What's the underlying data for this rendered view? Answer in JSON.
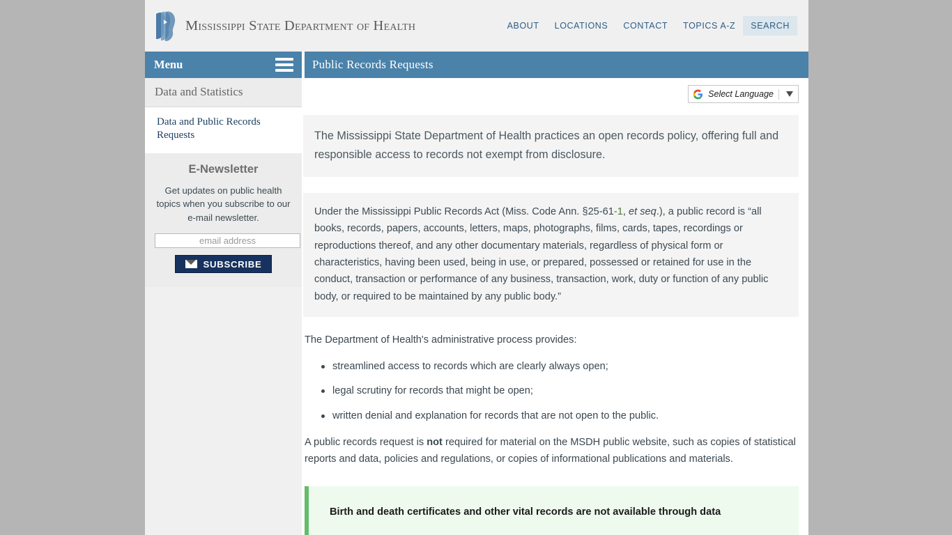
{
  "site": {
    "title": "Mississippi State Department of Health",
    "logo_icon": "msdh-profiles-logo-icon"
  },
  "topnav": {
    "items": [
      {
        "label": "ABOUT",
        "active": false
      },
      {
        "label": "LOCATIONS",
        "active": false
      },
      {
        "label": "CONTACT",
        "active": false
      },
      {
        "label": "TOPICS A-Z",
        "active": false
      },
      {
        "label": "SEARCH",
        "active": true
      }
    ]
  },
  "sidebar": {
    "menu_label": "Menu",
    "menu_icon": "hamburger-icon",
    "section_title": "Data and Statistics",
    "links": [
      {
        "label": "Data and Public Records Requests"
      }
    ],
    "newsletter": {
      "heading": "E-Newsletter",
      "description": "Get updates on public health topics when you subscribe to our e-mail newsletter.",
      "email_placeholder": "email address",
      "email_value": "",
      "subscribe_label": "SUBSCRIBE",
      "subscribe_icon": "envelope-icon"
    }
  },
  "main": {
    "page_title": "Public Records Requests",
    "translate": {
      "icon": "google-g-icon",
      "label": "Select Language",
      "caret_icon": "chevron-down-icon"
    },
    "lead": "The Mississippi State Department of Health practices an open records policy, offering full and responsible access to records not exempt from disclosure.",
    "statute": {
      "before_link": "Under the Mississippi Public Records Act (Miss. Code Ann. §25-61",
      "link": "-1",
      "after_link_1": ", ",
      "italic": "et seq",
      "after_link_2": ".), a public record is “all books, records, papers, accounts, letters, maps, photographs, films, cards, tapes, recordings or reproductions thereof, and any other documentary materials, regardless of physical form or characteristics, having been used, being in use, or prepared, possessed or retained for use in the conduct, transaction or performance of any business, transaction, work, duty or function of any public body, or required to be maintained by any public body.”"
    },
    "process_intro": "The Department of Health's administrative process provides:",
    "process_items": [
      "streamlined access to records which are clearly always open;",
      "legal scrutiny for records that might be open;",
      "written denial and explanation for records that are not open to the public."
    ],
    "notice": {
      "part1": "A public records request is ",
      "bold": "not",
      "part2": " required for material on the MSDH public website, such as copies of statistical reports and data, policies and regulations, or copies of informational publications and materials."
    },
    "callout": {
      "text": "Birth and death certificates and other vital records are not available through data"
    }
  },
  "colors": {
    "brand_blue": "#4a82aa",
    "link_blue": "#2e5d86",
    "navy": "#17325f",
    "callout_green": "#66bb6a",
    "statute_link_green": "#4f7a36"
  }
}
